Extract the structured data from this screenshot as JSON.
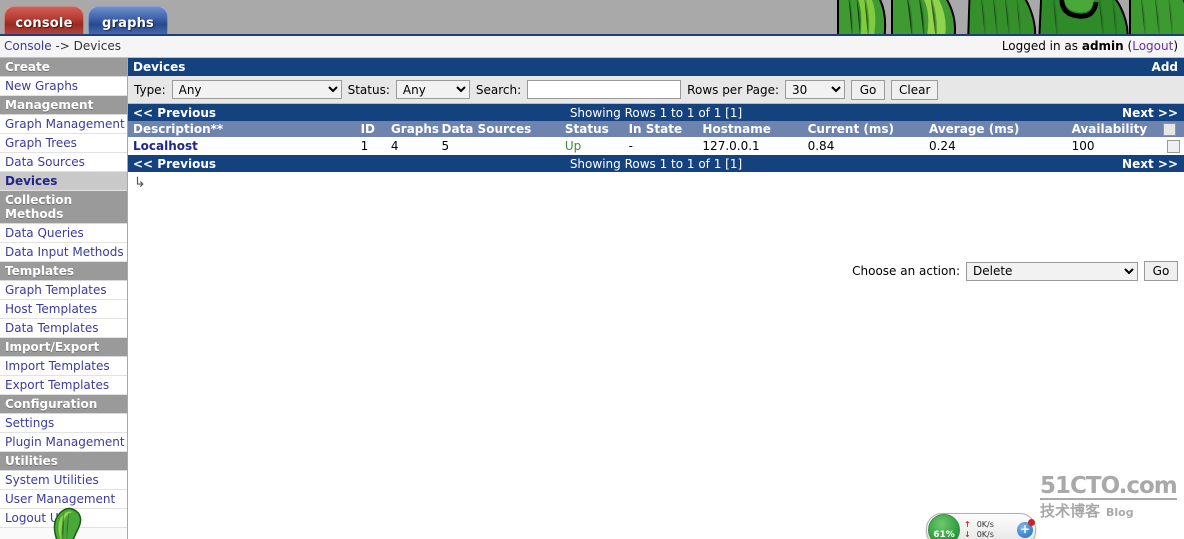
{
  "tabs": [
    {
      "label": "console",
      "name": "tab-console",
      "active": true
    },
    {
      "label": "graphs",
      "name": "tab-graphs",
      "active": false
    }
  ],
  "breadcrumb": {
    "root": "Console",
    "separator": "->",
    "current": "Devices"
  },
  "login": {
    "prefix": "Logged in as ",
    "user": "admin",
    "open_paren": " (",
    "logout": "Logout",
    "close_paren": ")"
  },
  "sidebar": {
    "items": [
      {
        "label": "Create",
        "type": "head"
      },
      {
        "label": "New Graphs",
        "type": "item"
      },
      {
        "label": "Management",
        "type": "head"
      },
      {
        "label": "Graph Management",
        "type": "item"
      },
      {
        "label": "Graph Trees",
        "type": "item"
      },
      {
        "label": "Data Sources",
        "type": "item"
      },
      {
        "label": "Devices",
        "type": "item",
        "selected": true
      },
      {
        "label": "Collection Methods",
        "type": "head"
      },
      {
        "label": "Data Queries",
        "type": "item"
      },
      {
        "label": "Data Input Methods",
        "type": "item"
      },
      {
        "label": "Templates",
        "type": "head"
      },
      {
        "label": "Graph Templates",
        "type": "item"
      },
      {
        "label": "Host Templates",
        "type": "item"
      },
      {
        "label": "Data Templates",
        "type": "item"
      },
      {
        "label": "Import/Export",
        "type": "head"
      },
      {
        "label": "Import Templates",
        "type": "item"
      },
      {
        "label": "Export Templates",
        "type": "item"
      },
      {
        "label": "Configuration",
        "type": "head"
      },
      {
        "label": "Settings",
        "type": "item"
      },
      {
        "label": "Plugin Management",
        "type": "item"
      },
      {
        "label": "Utilities",
        "type": "head"
      },
      {
        "label": "System Utilities",
        "type": "item"
      },
      {
        "label": "User Management",
        "type": "item"
      },
      {
        "label": "Logout User",
        "type": "item"
      }
    ]
  },
  "panel": {
    "title": "Devices",
    "add_label": "Add"
  },
  "filter": {
    "type_label": "Type:",
    "type_value": "Any",
    "status_label": "Status:",
    "status_value": "Any",
    "search_label": "Search:",
    "search_value": "",
    "search_placeholder": "",
    "rows_label": "Rows per Page:",
    "rows_value": "30",
    "go_label": "Go",
    "clear_label": "Clear"
  },
  "nav": {
    "previous": "<< Previous",
    "showing": "Showing Rows 1 to 1 of 1 [1]",
    "next": "Next >>"
  },
  "table": {
    "columns": [
      "Description**",
      "ID",
      "Graphs",
      "Data Sources",
      "Status",
      "In State",
      "Hostname",
      "Current (ms)",
      "Average (ms)",
      "Availability"
    ],
    "rows": [
      {
        "description": "Localhost",
        "id": "1",
        "graphs": "4",
        "data_sources": "5",
        "status": "Up",
        "in_state": "-",
        "hostname": "127.0.0.1",
        "current_ms": "0.84",
        "average_ms": "0.24",
        "availability": "100",
        "checked": false
      }
    ]
  },
  "subarrow_icon": "↳",
  "action": {
    "label": "Choose an action:",
    "value": "Delete",
    "go_label": "Go"
  },
  "watermark": {
    "top": "51CTO.com",
    "bottom": "技术博客",
    "blog": "Blog"
  },
  "sysmon": {
    "percent": "61%",
    "up_rate": "0K/s",
    "down_rate": "0K/s",
    "plus": "+"
  },
  "colors": {
    "nav_blue": "#14427f",
    "header_blue": "#6e84ae",
    "menu_head_gray": "#9a9a9a",
    "link_blue": "#3b3b9c",
    "status_up_green": "#3a8a3a",
    "tab_console_red": "#b33a31",
    "tab_graphs_blue": "#3a5fa8"
  }
}
